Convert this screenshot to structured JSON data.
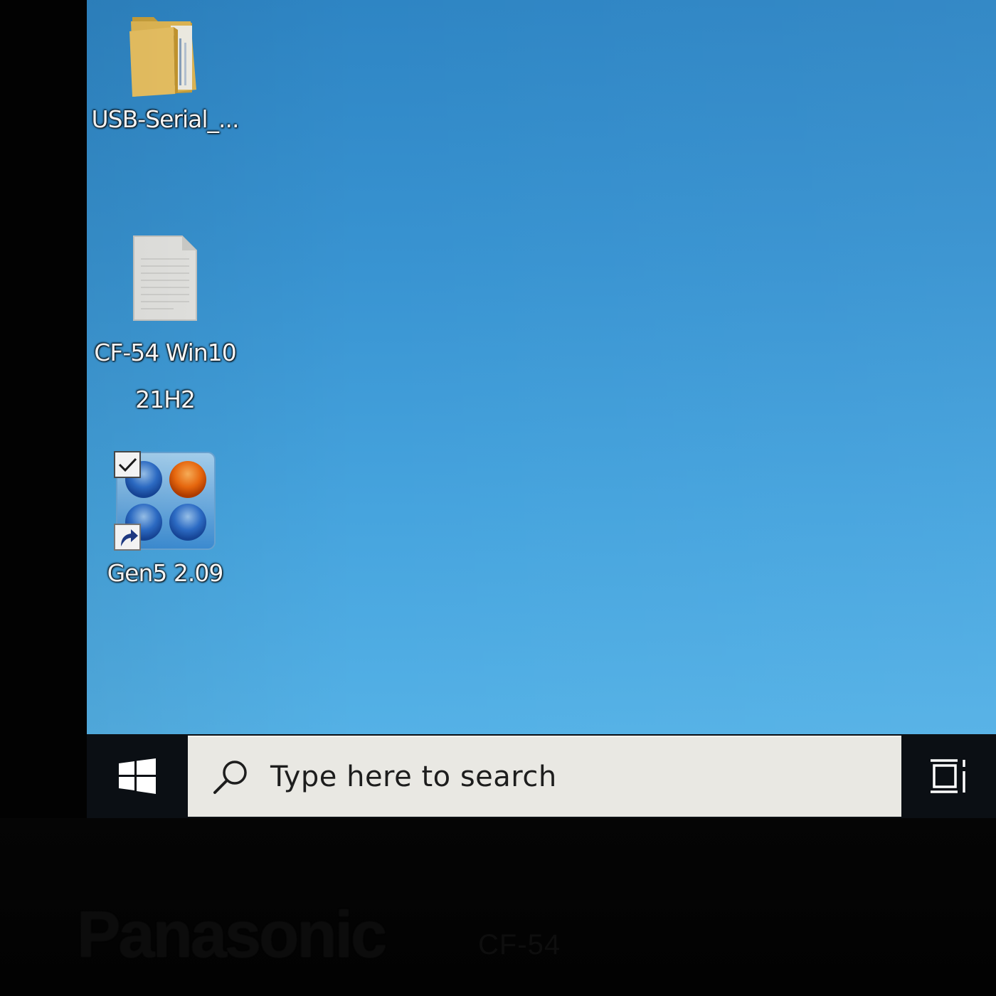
{
  "desktop": {
    "icons": [
      {
        "label": "USB-Serial_...",
        "icon": "folder-icon"
      },
      {
        "label_line1": "CF-54 Win10",
        "label_line2": "21H2",
        "icon": "document-icon"
      },
      {
        "label": "Gen5 2.09",
        "icon": "gen5-app-icon",
        "selected": true,
        "shortcut": true
      }
    ],
    "background_color": "#3893d1"
  },
  "taskbar": {
    "start_icon": "windows-logo-icon",
    "search": {
      "placeholder": "Type here to search",
      "icon": "search-icon"
    },
    "task_view_icon": "task-view-icon",
    "background_color": "#0b0f14"
  },
  "bezel": {
    "brand": "Panasonic",
    "model": "CF-54"
  }
}
